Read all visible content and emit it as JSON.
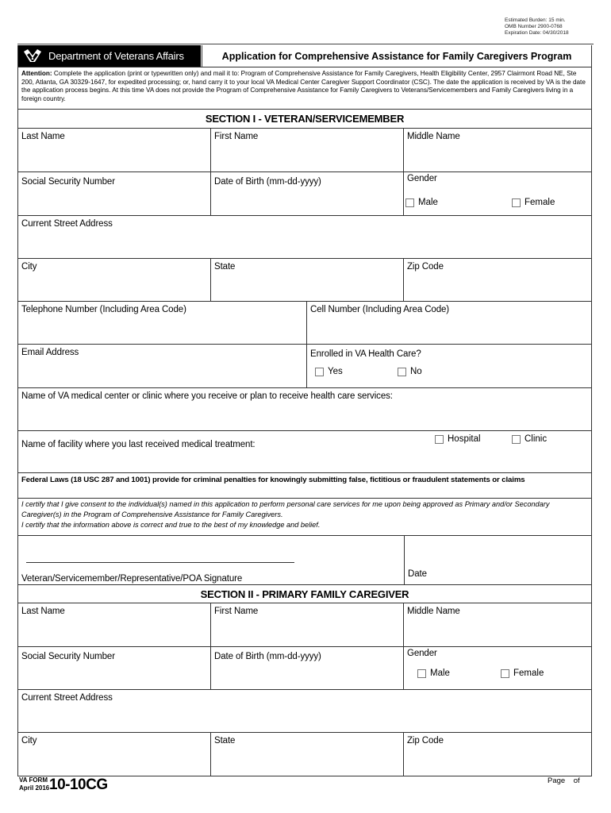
{
  "burden": {
    "estimated_burden": "Estimated Burden: 15 min.",
    "omb_number": "OMB Number 2900-0768",
    "expiration": "Expiration Date: 04/30/2018"
  },
  "header": {
    "logo_icon": "va-seal-icon",
    "agency": "Department of Veterans Affairs",
    "title": "Application for Comprehensive Assistance for Family Caregivers Program"
  },
  "attention": {
    "lead": "Attention:",
    "text": " Complete the application (print or typewritten only) and mail it to: Program of Comprehensive Assistance for Family Caregivers, Health Eligibility Center, 2957 Clairmont Road NE, Ste 200, Atlanta, GA 30329-1647, for expedited processing; or, hand carry it to your local VA Medical Center Caregiver Support Coordinator (CSC). The date the application is received by VA is the date the application process begins. At this time VA does not provide the Program of Comprehensive Assistance for Family Caregivers to Veterans/Servicemembers and Family Caregivers living in a foreign country."
  },
  "section1": {
    "title": "SECTION I - VETERAN/SERVICEMEMBER",
    "last_name": "Last Name",
    "first_name": "First Name",
    "middle_name": "Middle Name",
    "ssn": "Social Security Number",
    "dob": "Date of Birth (mm-dd-yyyy)",
    "gender": "Gender",
    "gender_options": [
      "Male",
      "Female"
    ],
    "street": "Current Street Address",
    "city": "City",
    "state": "State",
    "zip": "Zip Code",
    "telephone": "Telephone Number (Including Area Code)",
    "cell": "Cell Number (Including Area Code)",
    "email": "Email Address",
    "enrolled": "Enrolled in VA Health Care?",
    "enrolled_options": [
      "Yes",
      "No"
    ],
    "va_center": "Name of VA medical center or clinic where you receive or plan to receive health care services:",
    "facility": "Name of facility where you last received medical treatment:",
    "facility_options": [
      "Hospital",
      "Clinic"
    ],
    "federal_laws": "Federal Laws (18 USC 287 and 1001) provide for criminal penalties for knowingly submitting false, fictitious or fraudulent statements or claims",
    "certify_1": "I certify that I give consent to the individual(s) named in this application to perform personal care services for me upon being approved as Primary and/or Secondary Caregiver(s) in the Program of Comprehensive Assistance for Family Caregivers.",
    "certify_2": "I certify that the information above is correct and true to the best of my knowledge and belief.",
    "signature": "Veteran/Servicemember/Representative/POA Signature",
    "date": "Date"
  },
  "section2": {
    "title": "SECTION II - PRIMARY FAMILY CAREGIVER",
    "last_name": "Last Name",
    "first_name": "First Name",
    "middle_name": "Middle Name",
    "ssn": "Social Security Number",
    "dob": "Date of Birth (mm-dd-yyyy)",
    "gender": "Gender",
    "gender_options": [
      "Male",
      "Female"
    ],
    "street": "Current Street Address",
    "city": "City",
    "state": "State",
    "zip": "Zip Code"
  },
  "footer": {
    "va_form": "VA FORM",
    "date": "April 2016",
    "form_number": "10-10CG",
    "page": "Page    of"
  }
}
